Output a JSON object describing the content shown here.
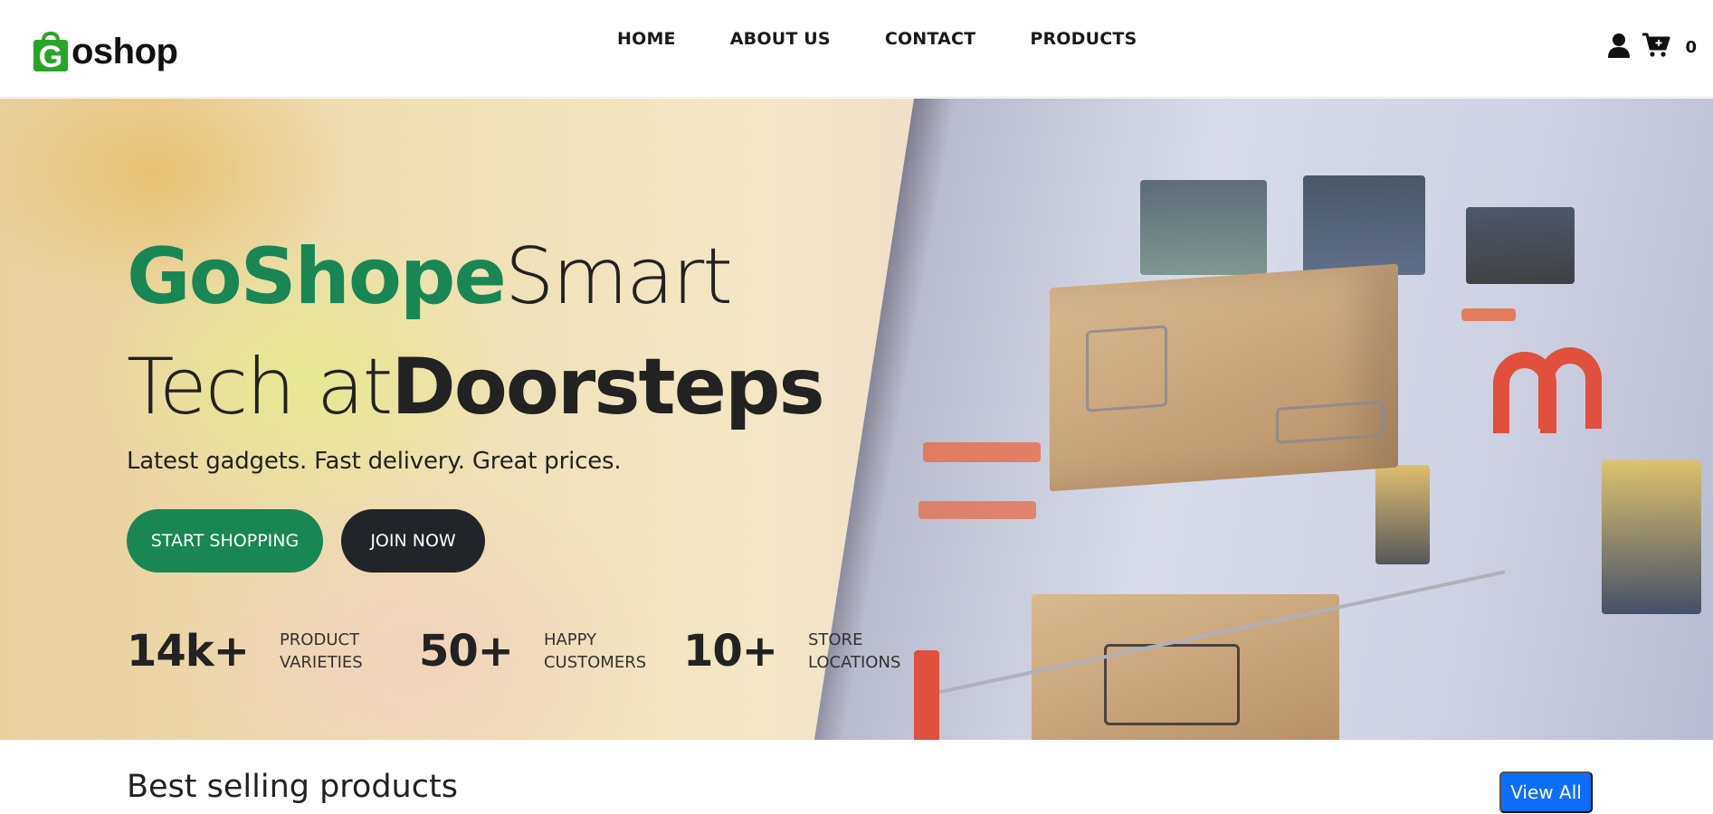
{
  "header": {
    "logo": {
      "letter": "G",
      "text": "oshop",
      "brand_color": "#2aa52a"
    },
    "nav": [
      {
        "label": "HOME"
      },
      {
        "label": "ABOUT US"
      },
      {
        "label": "CONTACT"
      },
      {
        "label": "PRODUCTS"
      }
    ],
    "icons": [
      "user-icon",
      "cart-icon"
    ],
    "cart_count": "0"
  },
  "hero": {
    "title_green": "GoShope",
    "title_light1": "Smart",
    "title_light2": "Tech at",
    "title_bold": "Doorsteps",
    "subtitle": "Latest gadgets. Fast delivery. Great prices.",
    "buttons": {
      "primary": "START SHOPPING",
      "secondary": "JOIN NOW"
    },
    "stats": [
      {
        "value": "14k+",
        "label_line1": "PRODUCT",
        "label_line2": "VARIETIES"
      },
      {
        "value": "50+",
        "label_line1": "HAPPY",
        "label_line2": "CUSTOMERS"
      },
      {
        "value": "10+",
        "label_line1": "STORE",
        "label_line2": "LOCATIONS"
      }
    ],
    "colors": {
      "accent": "#198754",
      "dark": "#212529"
    }
  },
  "best_selling": {
    "title": "Best selling products",
    "view_all": "View All",
    "button_color": "#0d6efd"
  }
}
